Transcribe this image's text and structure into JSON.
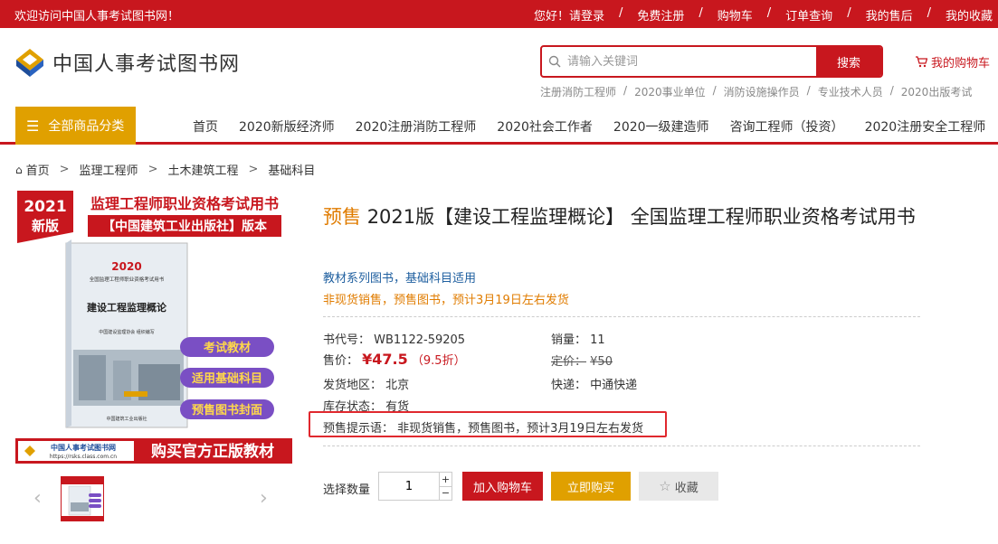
{
  "topbar": {
    "welcome": "欢迎访问中国人事考试图书网！",
    "links": [
      "您好！请登录",
      "免费注册",
      "购物车",
      "订单查询",
      "我的售后",
      "我的收藏"
    ],
    "separator": "/"
  },
  "logo": {
    "text": "中国人事考试图书网",
    "icon": "logo-icon"
  },
  "search": {
    "placeholder": "请输入关键词",
    "button": "搜索",
    "icon": "search-icon"
  },
  "mycart": {
    "label": "我的购物车",
    "icon": "cart-icon"
  },
  "hotwords": {
    "items": [
      "注册消防工程师",
      "2020事业单位",
      "消防设施操作员",
      "专业技术人员",
      "2020出版考试"
    ],
    "separator": "/"
  },
  "nav": {
    "all_categories": "全部商品分类",
    "items": [
      "首页",
      "2020新版经济师",
      "2020注册消防工程师",
      "2020社会工作者",
      "2020一级建造师",
      "咨询工程师（投资）",
      "2020注册安全工程师"
    ]
  },
  "breadcrumb": {
    "items": [
      "首页",
      "监理工程师",
      "土木建筑工程",
      "基础科目"
    ],
    "separator": ">"
  },
  "cover": {
    "year_badge": "2021",
    "badge_sub": "新版",
    "headline": "监理工程师职业资格考试用书",
    "publisher": "【中国建筑工业出版社】版本",
    "book_year": "2020",
    "book_series": "全国监理工程师职业资格考试用书",
    "book_title": "建设工程监理概论",
    "book_editor": "中国建设监理协会 组织编写",
    "book_publisher": "中国建筑工业出版社",
    "tags": [
      "考试教材",
      "适用基础科目",
      "预售图书封面"
    ],
    "banner_site": "中国人事考试图书网",
    "banner_url": "https://rsks.class.com.cn",
    "banner_slogan": "购买官方正版教材"
  },
  "thumbs": {
    "prev": "‹",
    "next": "›"
  },
  "product": {
    "presale_tag": "预售",
    "title": "2021版【建设工程监理概论】 全国监理工程师职业资格考试用书",
    "sub1": "教材系列图书，基础科目适用",
    "sub2": "非现货销售，预售图书，预计3月19日左右发货",
    "book_code_label": "书代号：",
    "book_code": "WB1122-59205",
    "sales_label": "销量：",
    "sales": "11",
    "price_label": "售价：",
    "price": "¥47.5",
    "discount": "（9.5折）",
    "list_price_label": "定价：",
    "list_price": "¥50",
    "ship_from_label": "发货地区：",
    "ship_from": "北京",
    "express_label": "快递：",
    "express": "中通快递",
    "stock_label": "库存状态：",
    "stock": "有货",
    "hint_label": "预售提示语：",
    "hint": "非现货销售，预售图书，预计3月19日左右发货"
  },
  "purchase": {
    "qty_label": "选择数量",
    "qty": "1",
    "plus": "+",
    "minus": "−",
    "add_to_cart": "加入购物车",
    "buy_now": "立即购买",
    "favorite": "收藏"
  },
  "colors": {
    "brand_red": "#c8171e",
    "accent_gold": "#e0a000",
    "presale_orange": "#e07c00",
    "link_blue": "#2060a0"
  }
}
